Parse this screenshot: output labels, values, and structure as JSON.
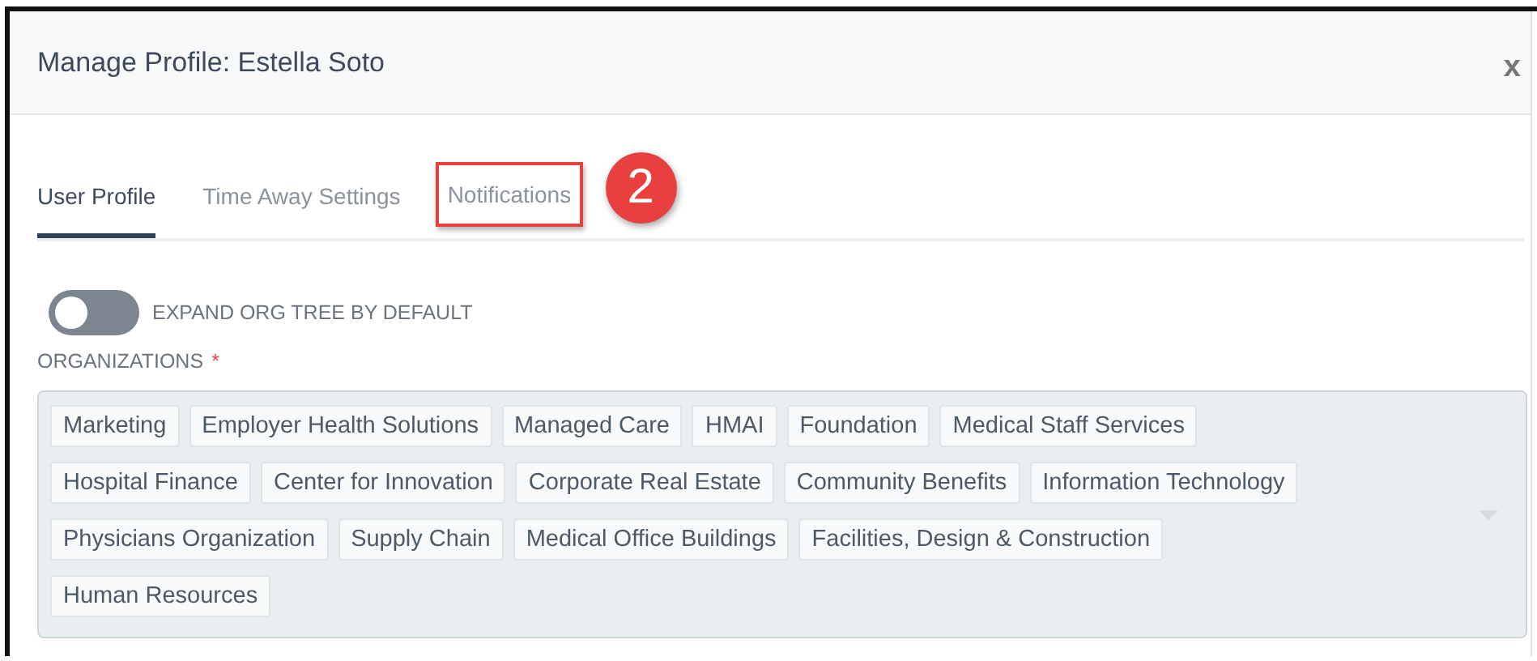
{
  "dialog": {
    "title": "Manage Profile: Estella Soto",
    "close": "x"
  },
  "tabs": [
    {
      "label": "User Profile",
      "selected": true,
      "annotated": false
    },
    {
      "label": "Time Away Settings",
      "selected": false,
      "annotated": false
    },
    {
      "label": "Notifications",
      "selected": false,
      "annotated": true
    }
  ],
  "callout": {
    "number": "2"
  },
  "toggle": {
    "label": "EXPAND ORG TREE BY DEFAULT",
    "on": false
  },
  "organizations": {
    "label": "ORGANIZATIONS",
    "required_mark": "*",
    "tags": [
      "Marketing",
      "Employer Health Solutions",
      "Managed Care",
      "HMAI",
      "Foundation",
      "Medical Staff Services",
      "Hospital Finance",
      "Center for Innovation",
      "Corporate Real Estate",
      "Community Benefits",
      "Information Technology",
      "Physicians Organization",
      "Supply Chain",
      "Medical Office Buildings",
      "Facilities, Design & Construction",
      "Human Resources"
    ]
  }
}
